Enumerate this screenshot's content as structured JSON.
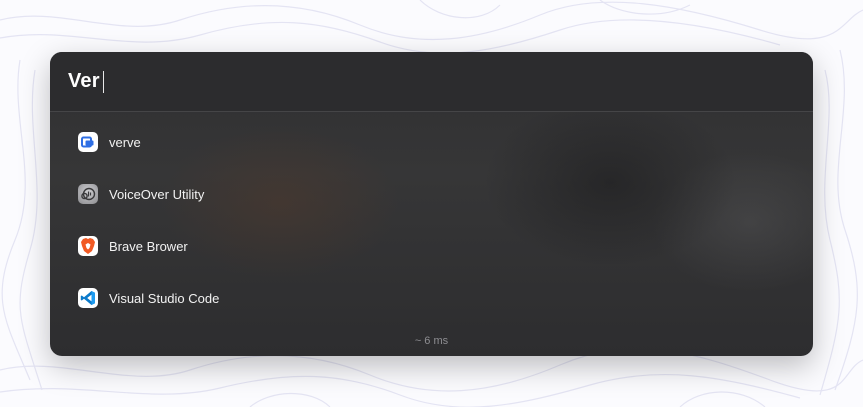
{
  "search": {
    "value": "Ver"
  },
  "results": [
    {
      "label": "verve",
      "icon": "verve-app-icon"
    },
    {
      "label": "VoiceOver Utility",
      "icon": "voiceover-utility-icon"
    },
    {
      "label": "Brave Brower",
      "icon": "brave-browser-icon"
    },
    {
      "label": "Visual Studio Code",
      "icon": "vscode-icon"
    }
  ],
  "footer": {
    "timing": "~ 6 ms"
  },
  "colors": {
    "panel_background": "#2f2f31",
    "page_background": "#fbfbfe",
    "brave_orange": "#f15a24",
    "vscode_blue": "#0a7acb",
    "verve_blue": "#2f6fe4"
  }
}
